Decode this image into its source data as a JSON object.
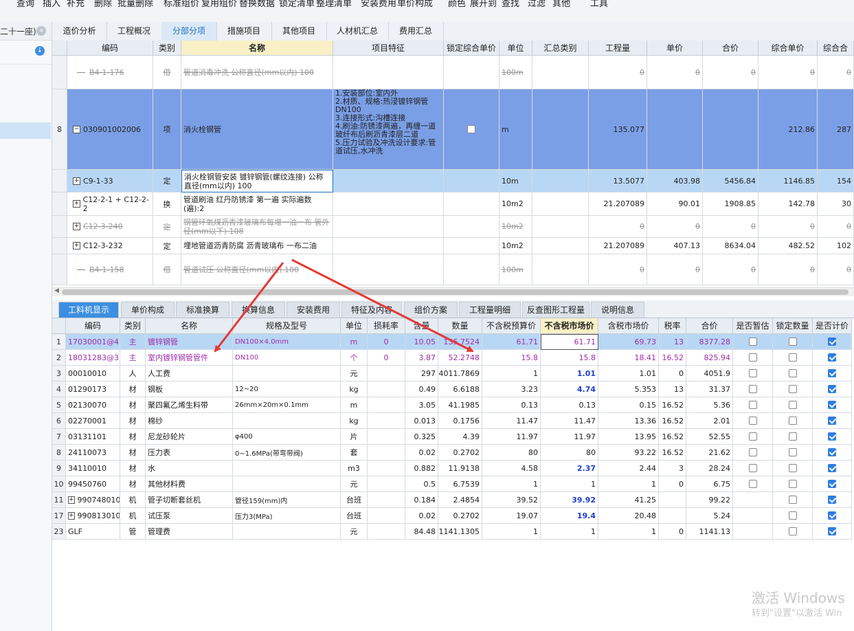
{
  "toolbar": {
    "items": [
      "查询",
      "插入",
      "补充",
      "删除",
      "批量删除",
      "标准组价",
      "复用组价",
      "替换数据",
      "锁定清单",
      "整理清单",
      "安装费用",
      "单价构成",
      "颜色",
      "展开到",
      "查找",
      "过滤",
      "其他",
      "工具"
    ]
  },
  "left_panel": {
    "title": "二十一座)"
  },
  "main_tabs": [
    "造价分析",
    "工程概况",
    "分部分项",
    "措施项目",
    "其他项目",
    "人材机汇总",
    "费用汇总"
  ],
  "upper_table": {
    "headers": [
      "编码",
      "类别",
      "名称",
      "项目特征",
      "锁定综合单价",
      "单位",
      "汇总类别",
      "工程量",
      "单价",
      "合价",
      "综合单价",
      "综合合"
    ],
    "rows": [
      {
        "num": "",
        "code": "B4-1-176",
        "cat": "借",
        "name": "管道消毒冲洗 公称直径(mm以内) 100",
        "feature": "",
        "unit": "100m",
        "qty": "0",
        "price": "0",
        "total": "0",
        "uprice": "0",
        "utotal": "0"
      },
      {
        "num": "8",
        "code": "030901002006",
        "cat": "项",
        "name": "消火栓钢管",
        "feature": "1.安装部位:室内外\n2.材质、规格:热浸镀锌钢管DN100\n3.连接形式:沟槽连接\n4.刷油:防锈漆两遍，再缠一道玻纤布后刷沥青漆层二道\n5.压力试验及冲洗设计要求:管道试压,水冲洗",
        "unit": "m",
        "qty": "135.077",
        "price": "",
        "total": "",
        "uprice": "212.86",
        "utotal": "287"
      },
      {
        "num": "",
        "code": "C9-1-33",
        "cat": "定",
        "name": "消火栓钢管安装 镀锌钢管(螺纹连接) 公称直径(mm以内) 100",
        "feature": "",
        "unit": "10m",
        "qty": "13.5077",
        "price": "403.98",
        "total": "5456.84",
        "uprice": "1146.85",
        "utotal": "154"
      },
      {
        "num": "",
        "code": "C12-2-1 + C12-2-2",
        "cat": "换",
        "name": "管道刷油 红丹防锈漆 第一遍  实际遍数(遍):2",
        "feature": "",
        "unit": "10m2",
        "qty": "21.207089",
        "price": "90.01",
        "total": "1908.85",
        "uprice": "142.78",
        "utotal": "30"
      },
      {
        "num": "",
        "code": "C12-3-240",
        "cat": "定",
        "name": "钢管环氧煤沥青漆玻璃布每增一油一布 管外径(mm以下) 108",
        "feature": "",
        "unit": "10m2",
        "qty": "0",
        "price": "0",
        "total": "0",
        "uprice": "0",
        "utotal": "0"
      },
      {
        "num": "",
        "code": "C12-3-232",
        "cat": "定",
        "name": "埋地管道沥青防腐 沥青玻璃布 一布二油",
        "feature": "",
        "unit": "10m2",
        "qty": "21.207089",
        "price": "407.13",
        "total": "8634.04",
        "uprice": "482.52",
        "utotal": "102"
      },
      {
        "num": "",
        "code": "B4-1-158",
        "cat": "借",
        "name": "管道试压 公称直径(mm以内) 100",
        "feature": "",
        "unit": "100m",
        "qty": "0",
        "price": "0",
        "total": "0",
        "uprice": "0",
        "utotal": "0"
      }
    ]
  },
  "bottom_tabs": [
    "工料机显示",
    "单价构成",
    "标准换算",
    "换算信息",
    "安装费用",
    "特征及内容",
    "组价方案",
    "工程量明细",
    "反查图形工程量",
    "说明信息"
  ],
  "lower_table": {
    "headers": [
      "编码",
      "类别",
      "名称",
      "规格及型号",
      "单位",
      "损耗率",
      "含量",
      "数量",
      "不含税预算价",
      "不含税市场价",
      "含税市场价",
      "税率",
      "合价",
      "是否暂估",
      "锁定数量",
      "是否计价"
    ],
    "rows": [
      {
        "num": "1",
        "code": "17030001@4",
        "cat": "主",
        "name": "镀锌钢管",
        "spec": "DN100×4.0mm",
        "unit": "m",
        "loss": "0",
        "content": "10.05",
        "qty": "135.7524",
        "budget": "61.71",
        "market": "61.71",
        "taxmarket": "69.73",
        "rate": "13",
        "total": "8377.28"
      },
      {
        "num": "2",
        "code": "18031283@3",
        "cat": "主",
        "name": "室内镀锌钢管管件",
        "spec": "DN100",
        "unit": "个",
        "loss": "0",
        "content": "3.87",
        "qty": "52.2748",
        "budget": "15.8",
        "market": "15.8",
        "taxmarket": "18.41",
        "rate": "16.52",
        "total": "825.94"
      },
      {
        "num": "3",
        "code": "00010010",
        "cat": "人",
        "name": "人工费",
        "spec": "",
        "unit": "元",
        "loss": "",
        "content": "297",
        "qty": "4011.7869",
        "budget": "1",
        "market": "1.01",
        "taxmarket": "1.01",
        "rate": "0",
        "total": "4051.9"
      },
      {
        "num": "4",
        "code": "01290173",
        "cat": "材",
        "name": "钢板",
        "spec": "12~20",
        "unit": "kg",
        "loss": "",
        "content": "0.49",
        "qty": "6.6188",
        "budget": "3.23",
        "market": "4.74",
        "taxmarket": "5.353",
        "rate": "13",
        "total": "31.37"
      },
      {
        "num": "5",
        "code": "02130070",
        "cat": "材",
        "name": "聚四氟乙烯生料带",
        "spec": "26mm×20m×0.1mm",
        "unit": "m",
        "loss": "",
        "content": "3.05",
        "qty": "41.1985",
        "budget": "0.13",
        "market": "0.13",
        "taxmarket": "0.15",
        "rate": "16.52",
        "total": "5.36"
      },
      {
        "num": "6",
        "code": "02270001",
        "cat": "材",
        "name": "棉纱",
        "spec": "",
        "unit": "kg",
        "loss": "",
        "content": "0.013",
        "qty": "0.1756",
        "budget": "11.47",
        "market": "11.47",
        "taxmarket": "13.36",
        "rate": "16.52",
        "total": "2.01"
      },
      {
        "num": "7",
        "code": "03131101",
        "cat": "材",
        "name": "尼龙砂轮片",
        "spec": "φ400",
        "unit": "片",
        "loss": "",
        "content": "0.325",
        "qty": "4.39",
        "budget": "11.97",
        "market": "11.97",
        "taxmarket": "13.95",
        "rate": "16.52",
        "total": "52.55"
      },
      {
        "num": "8",
        "code": "24110073",
        "cat": "材",
        "name": "压力表",
        "spec": "0~1.6MPa(带弯带阀)",
        "unit": "套",
        "loss": "",
        "content": "0.02",
        "qty": "0.2702",
        "budget": "80",
        "market": "80",
        "taxmarket": "93.22",
        "rate": "16.52",
        "total": "21.62"
      },
      {
        "num": "9",
        "code": "34110010",
        "cat": "材",
        "name": "水",
        "spec": "",
        "unit": "m3",
        "loss": "",
        "content": "0.882",
        "qty": "11.9138",
        "budget": "4.58",
        "market": "2.37",
        "taxmarket": "2.44",
        "rate": "3",
        "total": "28.24"
      },
      {
        "num": "10",
        "code": "99450760",
        "cat": "材",
        "name": "其他材料费",
        "spec": "",
        "unit": "元",
        "loss": "",
        "content": "0.5",
        "qty": "6.7539",
        "budget": "1",
        "market": "1",
        "taxmarket": "1",
        "rate": "0",
        "total": "6.75"
      },
      {
        "num": "11",
        "code": "990748010",
        "cat": "机",
        "name": "管子切断套丝机",
        "spec": "管径159(mm)内",
        "unit": "台班",
        "loss": "",
        "content": "0.184",
        "qty": "2.4854",
        "budget": "39.52",
        "market": "39.92",
        "taxmarket": "41.25",
        "rate": "",
        "total": "99.22"
      },
      {
        "num": "17",
        "code": "990813010",
        "cat": "机",
        "name": "试压泵",
        "spec": "压力3(MPa)",
        "unit": "台班",
        "loss": "",
        "content": "0.02",
        "qty": "0.2702",
        "budget": "19.07",
        "market": "19.4",
        "taxmarket": "20.48",
        "rate": "",
        "total": "5.24"
      },
      {
        "num": "23",
        "code": "GLF",
        "cat": "管",
        "name": "管理费",
        "spec": "",
        "unit": "元",
        "loss": "",
        "content": "84.48",
        "qty": "1141.1305",
        "budget": "1",
        "market": "1",
        "taxmarket": "1",
        "rate": "0",
        "total": "1141.13"
      }
    ]
  },
  "watermark": {
    "line1": "激活 Windows",
    "line2": "转到\"设置\"以激活 Win"
  },
  "colors": {
    "selected_row": "#7b9fe6",
    "active_row": "#b8d7f5",
    "arrow": "#e53935",
    "main_material": "#a02ca8",
    "changed_price": "#1d3fd0"
  }
}
